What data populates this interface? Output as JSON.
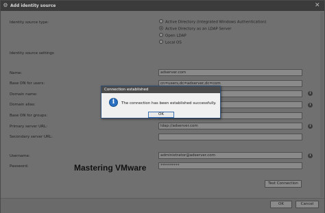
{
  "window": {
    "title": "Add identity source"
  },
  "identity_source_type": {
    "label": "Identity source type:",
    "options": [
      {
        "label": "Active Directory (Integrated Windows Authentication)",
        "selected": false
      },
      {
        "label": "Active Directory as an LDAP Server",
        "selected": true
      },
      {
        "label": "Open LDAP",
        "selected": false
      },
      {
        "label": "Local OS",
        "selected": false
      }
    ]
  },
  "settings": {
    "heading": "Identity source settings",
    "name": {
      "label": "Name:",
      "value": "adserver.com"
    },
    "base_dn_users": {
      "label": "Base DN for users:",
      "value": "cn=users,dc=adserver,dc=com"
    },
    "domain_name": {
      "label": "Domain name:",
      "value": ""
    },
    "domain_alias": {
      "label": "Domain alias:",
      "value": ""
    },
    "base_dn_groups": {
      "label": "Base DN for groups:",
      "value": ""
    },
    "primary_server_url": {
      "label": "Primary server URL:",
      "value": "ldap://adserver.com"
    },
    "secondary_server_url": {
      "label": "Secondary server URL:",
      "value": ""
    },
    "username": {
      "label": "Username:",
      "value": "administrator@adserver.com"
    },
    "password": {
      "label": "Password:",
      "value": "**********"
    }
  },
  "buttons": {
    "test_connection": "Test Connection",
    "ok": "OK",
    "cancel": "Cancel"
  },
  "watermark": "Mastering VMware",
  "dialog": {
    "title": "Connection established",
    "message": "The connection has been established successfully.",
    "ok": "OK"
  },
  "colors": {
    "titlebar": "#3b3b3b",
    "overlay_background": "#707070",
    "dialog_background": "#f0f0f0",
    "info_icon": "#2a6fc0"
  }
}
